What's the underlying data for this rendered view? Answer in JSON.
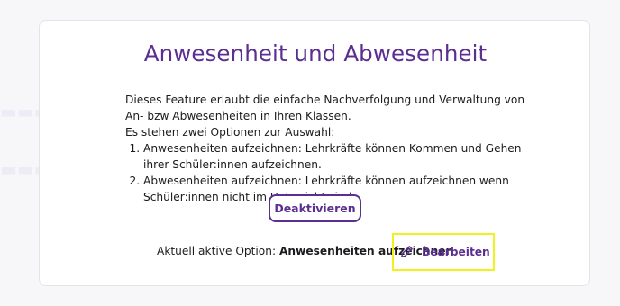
{
  "feature": {
    "title": "Anwesenheit und Abwesenheit",
    "description_line1": "Dieses Feature erlaubt die einfache Nachverfolgung und Verwaltung von An- bzw Abwesenheiten in Ihren Klassen.",
    "description_line2": "Es stehen zwei Optionen zur Auswahl:",
    "options": [
      "Anwesenheiten aufzeichnen: Lehrkräfte können Kommen und Gehen ihrer Schüler:innen aufzeichnen.",
      "Abwesenheiten aufzeichnen: Lehrkräfte können aufzeichnen wenn Schüler:innen nicht im Unterricht sind."
    ],
    "deactivate_label": "Deaktivieren",
    "current_prefix": "Aktuell aktive Option:",
    "current_value": "Anwesenheiten aufzeichnen",
    "edit_label": "Bearbeiten",
    "edit_icon": "pencil-icon"
  },
  "colors": {
    "accent": "#5b2e91",
    "highlight": "#f0f21c",
    "background": "#f7f7f9",
    "card": "#ffffff"
  }
}
